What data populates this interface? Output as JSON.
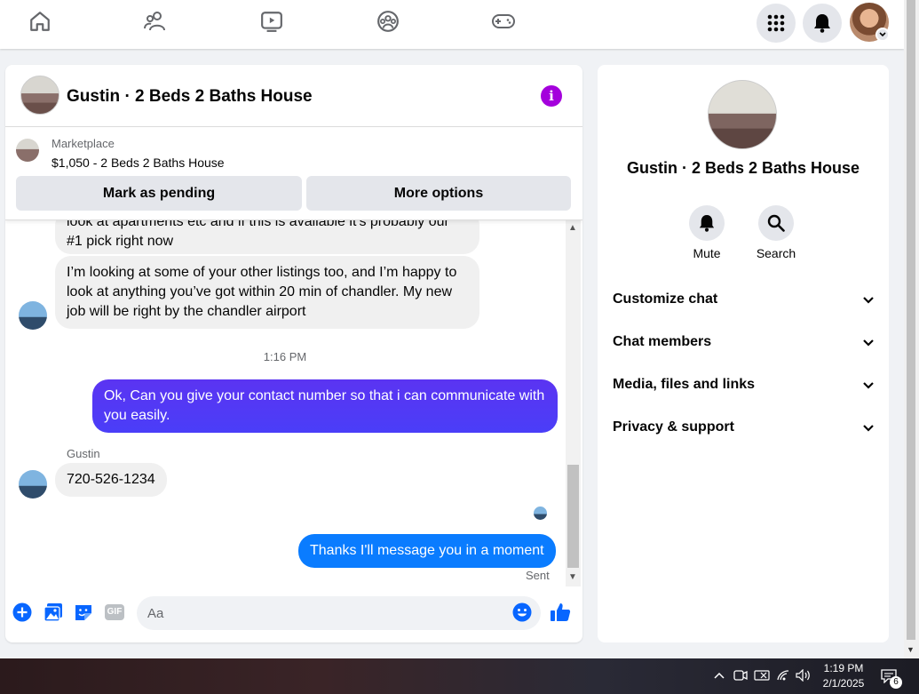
{
  "nav": {
    "icons": [
      "home-icon",
      "friends-icon",
      "watch-icon",
      "groups-icon",
      "gaming-icon"
    ],
    "right_icons": [
      "menu-grid-icon",
      "notifications-icon",
      "account-avatar"
    ]
  },
  "chat": {
    "title": "Gustin · 2 Beds 2 Baths House",
    "marketplace": {
      "label": "Marketplace",
      "listing": "$1,050 - 2 Beds 2 Baths House",
      "mark_pending_label": "Mark as pending",
      "more_options_label": "More options"
    },
    "messages": [
      {
        "from": "them",
        "text_line1": "look at apartments etc and if this is available it's probably our",
        "text_line2": "#1 pick right now"
      },
      {
        "from": "them",
        "text": "I’m looking at some of your other listings too, and I’m happy to look at anything you’ve got within 20 min of chandler. My new job will be right by the chandler airport"
      },
      {
        "timestamp": "1:16 PM"
      },
      {
        "from": "me",
        "text": "Ok, Can you give your contact number so that i can communicate with you easily."
      },
      {
        "from": "them",
        "sender": "Gustin",
        "text": "720-526-1234"
      },
      {
        "from": "me",
        "text": "Thanks I'll message you in a moment",
        "status": "Sent"
      }
    ],
    "composer": {
      "placeholder": "Aa",
      "icons": [
        "add-icon",
        "photo-icon",
        "sticker-icon",
        "gif-icon",
        "emoji-icon",
        "like-icon"
      ],
      "gif_label": "GIF"
    }
  },
  "side": {
    "title": "Gustin · 2 Beds 2 Baths House",
    "actions": [
      {
        "label": "Mute",
        "icon": "bell-icon"
      },
      {
        "label": "Search",
        "icon": "search-icon"
      }
    ],
    "sections": [
      "Customize chat",
      "Chat members",
      "Media, files and links",
      "Privacy & support"
    ]
  },
  "taskbar": {
    "time": "1:19 PM",
    "date": "2/1/2025",
    "notif_count": "6"
  },
  "colors": {
    "accent": "#0866ff",
    "info": "#a400dc",
    "bubble_gradient_top": "#6b2cf5",
    "bubble_blue": "#0a7cff"
  }
}
